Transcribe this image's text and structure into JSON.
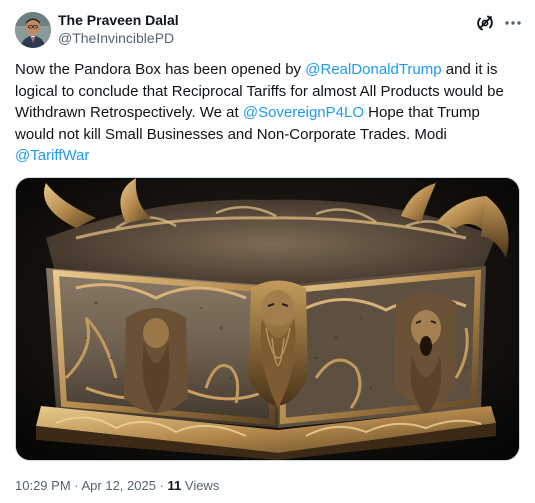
{
  "author": {
    "display_name": "The Praveen Dalal",
    "handle": "@TheInvinciblePD",
    "avatar_icon": "user-avatar"
  },
  "actions": {
    "grok_icon": "grok-icon",
    "more_icon": "more-icon"
  },
  "post": {
    "text_1": "Now the Pandora Box has been opened by ",
    "mention_1": "@RealDonaldTrump",
    "text_2": " and it is logical to conclude that Reciprocal Tariffs for almost All Products would be Withdrawn Retrospectively. We at ",
    "mention_2": "@SovereignP4LO",
    "text_3": " Hope that Trump would not kill Small Businesses and Non-Corporate Trades. Modi ",
    "mention_3": "@TariffWar"
  },
  "media": {
    "image_icon": "pandora-box-image"
  },
  "meta": {
    "time": "10:29 PM",
    "separator_1": " · ",
    "date": "Apr 12, 2025",
    "separator_2": " · ",
    "views_count": "11",
    "views_label": " Views"
  },
  "colors": {
    "link": "#1d9bf0",
    "secondary_text": "#536471",
    "primary_text": "#0f1419",
    "border": "#cfd9de"
  }
}
